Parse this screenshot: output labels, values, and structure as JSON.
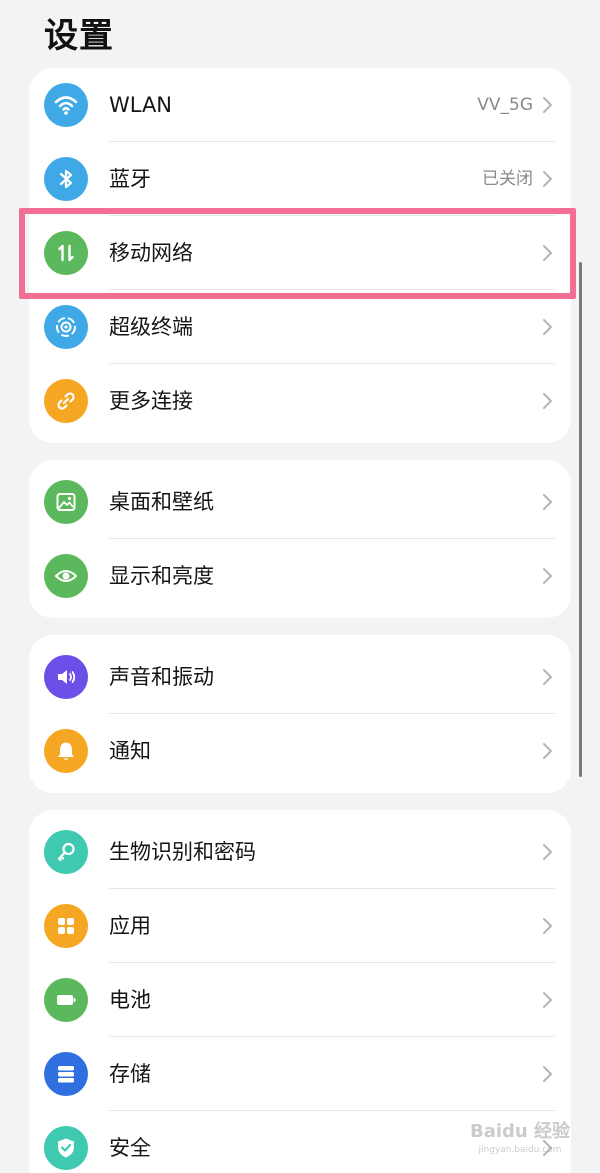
{
  "header": {
    "title": "设置"
  },
  "groups": [
    {
      "items": [
        {
          "label": "WLAN",
          "value": "VV_5G",
          "icon": "wifi-icon",
          "color": "#3fa8e6"
        },
        {
          "label": "蓝牙",
          "value": "已关闭",
          "icon": "bluetooth-icon",
          "color": "#3fa8e6"
        },
        {
          "label": "移动网络",
          "value": "",
          "icon": "mobile-data-icon",
          "color": "#5cb85c"
        },
        {
          "label": "超级终端",
          "value": "",
          "icon": "super-device-icon",
          "color": "#3fa8e6"
        },
        {
          "label": "更多连接",
          "value": "",
          "icon": "link-icon",
          "color": "#f5a623"
        }
      ]
    },
    {
      "items": [
        {
          "label": "桌面和壁纸",
          "value": "",
          "icon": "wallpaper-icon",
          "color": "#5cb85c"
        },
        {
          "label": "显示和亮度",
          "value": "",
          "icon": "eye-icon",
          "color": "#5cb85c"
        }
      ]
    },
    {
      "items": [
        {
          "label": "声音和振动",
          "value": "",
          "icon": "speaker-icon",
          "color": "#6b4fe6"
        },
        {
          "label": "通知",
          "value": "",
          "icon": "bell-icon",
          "color": "#f5a623"
        }
      ]
    },
    {
      "items": [
        {
          "label": "生物识别和密码",
          "value": "",
          "icon": "key-icon",
          "color": "#3ec9b0"
        },
        {
          "label": "应用",
          "value": "",
          "icon": "apps-icon",
          "color": "#f5a623"
        },
        {
          "label": "电池",
          "value": "",
          "icon": "battery-icon",
          "color": "#5cb85c"
        },
        {
          "label": "存储",
          "value": "",
          "icon": "storage-icon",
          "color": "#2f6fe0"
        },
        {
          "label": "安全",
          "value": "",
          "icon": "shield-check-icon",
          "color": "#3ec9b0"
        }
      ]
    }
  ],
  "highlight_color": "#f26e94",
  "watermark": {
    "text": "Baidu 经验",
    "sub": "jingyan.baidu.com"
  }
}
